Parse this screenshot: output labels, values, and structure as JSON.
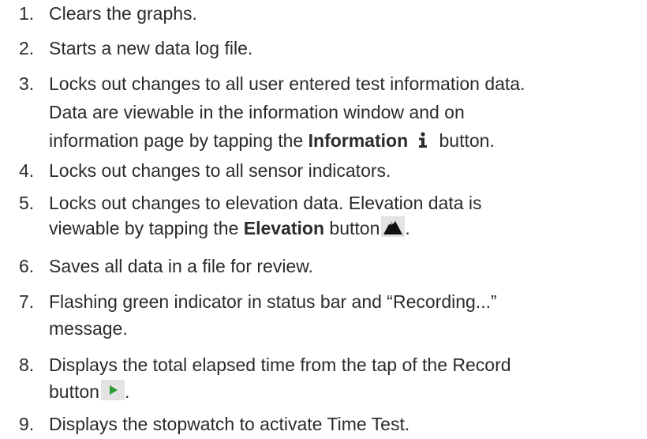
{
  "items": [
    {
      "num": "1.",
      "lines": [
        "Clears the graphs."
      ]
    },
    {
      "num": "2.",
      "lines": [
        "Starts a new data log file."
      ]
    },
    {
      "num": "3.",
      "line1": "Locks out changes to all user entered test information data.",
      "line2": "Data are viewable in the information window and on",
      "line3_pre": "information page by tapping the ",
      "line3_bold": "Information",
      "line3_post": " button.",
      "icon": "info-icon"
    },
    {
      "num": "4.",
      "lines": [
        "Locks out changes to all sensor indicators."
      ]
    },
    {
      "num": "5.",
      "line1": "Locks out changes to elevation data. Elevation data is",
      "line2_pre": "viewable by tapping the ",
      "line2_bold": "Elevation",
      "line2_post": " button",
      "line2_end": ".",
      "icon": "mountain-icon"
    },
    {
      "num": "6.",
      "lines": [
        "Saves all data in a file for review."
      ]
    },
    {
      "num": "7.",
      "line1": "Flashing green indicator in status bar and “Recording...”",
      "line2": "message."
    },
    {
      "num": "8.",
      "line1": "Displays the total elapsed time from the tap of the Record",
      "line2": "button",
      "line2_end": ".",
      "icon": "play-icon"
    },
    {
      "num": "9.",
      "lines": [
        "Displays the stopwatch to activate Time Test."
      ]
    }
  ],
  "colors": {
    "text": "#2b2b2b",
    "button_bg": "#e3e3e3",
    "play_green": "#2f9a2f"
  }
}
